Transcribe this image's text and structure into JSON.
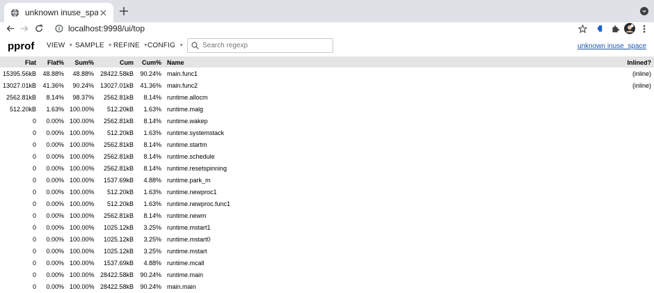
{
  "browser": {
    "tab_title": "unknown inuse_space",
    "url": "localhost:9998/ui/top"
  },
  "app": {
    "logo": "pprof",
    "menus": [
      "VIEW",
      "SAMPLE",
      "REFINE",
      "CONFIG"
    ],
    "search_placeholder": "Search regexp",
    "profile_link": "unknown inuse_space"
  },
  "table": {
    "columns": [
      "Flat",
      "Flat%",
      "Sum%",
      "Cum",
      "Cum%",
      "Name",
      "Inlined?"
    ],
    "rows": [
      [
        "15395.56kB",
        "48.88%",
        "48.88%",
        "28422.58kB",
        "90.24%",
        "main.func1",
        "(inline)"
      ],
      [
        "13027.01kB",
        "41.36%",
        "90.24%",
        "13027.01kB",
        "41.36%",
        "main.func2",
        "(inline)"
      ],
      [
        "2562.81kB",
        "8.14%",
        "98.37%",
        "2562.81kB",
        "8.14%",
        "runtime.allocm",
        ""
      ],
      [
        "512.20kB",
        "1.63%",
        "100.00%",
        "512.20kB",
        "1.63%",
        "runtime.malg",
        ""
      ],
      [
        "0",
        "0.00%",
        "100.00%",
        "2562.81kB",
        "8.14%",
        "runtime.wakep",
        ""
      ],
      [
        "0",
        "0.00%",
        "100.00%",
        "512.20kB",
        "1.63%",
        "runtime.systemstack",
        ""
      ],
      [
        "0",
        "0.00%",
        "100.00%",
        "2562.81kB",
        "8.14%",
        "runtime.startm",
        ""
      ],
      [
        "0",
        "0.00%",
        "100.00%",
        "2562.81kB",
        "8.14%",
        "runtime.schedule",
        ""
      ],
      [
        "0",
        "0.00%",
        "100.00%",
        "2562.81kB",
        "8.14%",
        "runtime.resetspinning",
        ""
      ],
      [
        "0",
        "0.00%",
        "100.00%",
        "1537.69kB",
        "4.88%",
        "runtime.park_m",
        ""
      ],
      [
        "0",
        "0.00%",
        "100.00%",
        "512.20kB",
        "1.63%",
        "runtime.newproc1",
        ""
      ],
      [
        "0",
        "0.00%",
        "100.00%",
        "512.20kB",
        "1.63%",
        "runtime.newproc.func1",
        ""
      ],
      [
        "0",
        "0.00%",
        "100.00%",
        "2562.81kB",
        "8.14%",
        "runtime.newm",
        ""
      ],
      [
        "0",
        "0.00%",
        "100.00%",
        "1025.12kB",
        "3.25%",
        "runtime.mstart1",
        ""
      ],
      [
        "0",
        "0.00%",
        "100.00%",
        "1025.12kB",
        "3.25%",
        "runtime.mstart0",
        ""
      ],
      [
        "0",
        "0.00%",
        "100.00%",
        "1025.12kB",
        "3.25%",
        "runtime.mstart",
        ""
      ],
      [
        "0",
        "0.00%",
        "100.00%",
        "1537.69kB",
        "4.88%",
        "runtime.mcall",
        ""
      ],
      [
        "0",
        "0.00%",
        "100.00%",
        "28422.58kB",
        "90.24%",
        "runtime.main",
        ""
      ],
      [
        "0",
        "0.00%",
        "100.00%",
        "28422.58kB",
        "90.24%",
        "main.main",
        ""
      ]
    ]
  },
  "icons": {
    "tab_favicon": "globe-icon",
    "tab_close": "close-icon",
    "new_tab": "plus-icon",
    "back": "back-arrow-icon",
    "forward": "forward-arrow-icon",
    "reload": "reload-icon",
    "site_info": "info-icon",
    "bookmark": "star-icon",
    "extension_1": "password-manager-icon",
    "extensions": "puzzle-icon",
    "profile": "avatar",
    "browser_menu": "kebab-menu-icon",
    "search": "search-icon"
  },
  "colors": {
    "tabstrip_bg": "#dee1e6",
    "table_header_bg": "#e4e4e4",
    "link": "#1a55a8"
  }
}
